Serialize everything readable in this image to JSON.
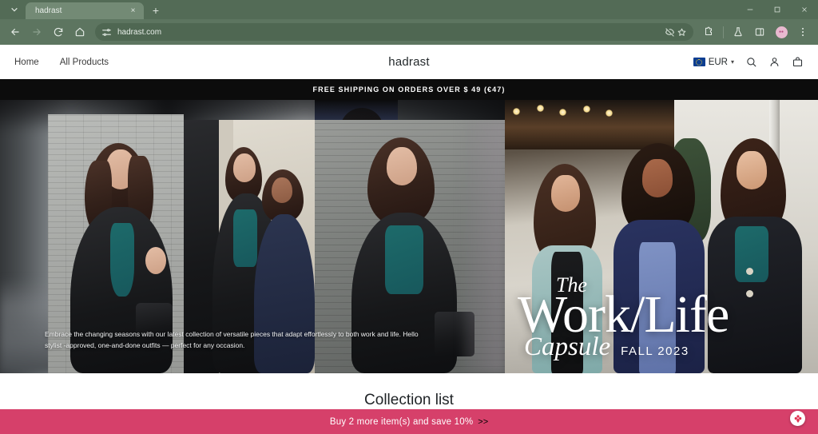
{
  "browser": {
    "tab": {
      "title": "hadrast",
      "close_label": "×"
    },
    "newtab_label": "+",
    "omnibox": {
      "url": "hadrast.com"
    },
    "icons": {
      "tab_search": "tab-search-icon",
      "back": "back-arrow-icon",
      "forward": "forward-arrow-icon",
      "reload": "reload-icon",
      "home": "home-icon",
      "site_settings": "tune-icon",
      "tracking": "eye-off-icon",
      "bookmark": "star-icon",
      "extensions": "extensions-icon",
      "labs": "flask-icon",
      "side_panel": "side-panel-icon",
      "profile": "profile-avatar-icon",
      "menu": "three-dot-menu-icon",
      "minimize": "minimize-icon",
      "maximize": "maximize-icon",
      "close": "window-close-icon"
    }
  },
  "site": {
    "logo": "hadrast",
    "nav": [
      {
        "label": "Home"
      },
      {
        "label": "All Products"
      }
    ],
    "currency": {
      "code": "EUR",
      "caret": "⌄",
      "flag": "eu-flag-icon"
    },
    "header_icons": [
      {
        "name": "search-icon"
      },
      {
        "name": "account-icon"
      },
      {
        "name": "cart-icon"
      }
    ],
    "announcement": "FREE SHIPPING ON ORDERS OVER  $ 49  (€47)"
  },
  "hero": {
    "body": "Embrace the changing seasons with our latest collection of versatile pieces that adapt effortlessly to both work and life. Hello stylist -approved, one-and-done outfits — perfect for any occasion.",
    "title_the": "The",
    "title_main": "Work/Life",
    "title_capsule": "Capsule",
    "title_season": "FALL 2023"
  },
  "collection": {
    "title": "Collection list"
  },
  "promo": {
    "text": "Buy 2 more item(s) and save 10%",
    "arrow": ">>",
    "badge_icon": "flower-logo-icon"
  },
  "colors": {
    "browser_chrome": "#5d7560",
    "tab_active": "#738a75",
    "announcement_bg": "#0c0c0c",
    "promo_bg": "#d6406a",
    "page_bg": "#ffffff"
  }
}
